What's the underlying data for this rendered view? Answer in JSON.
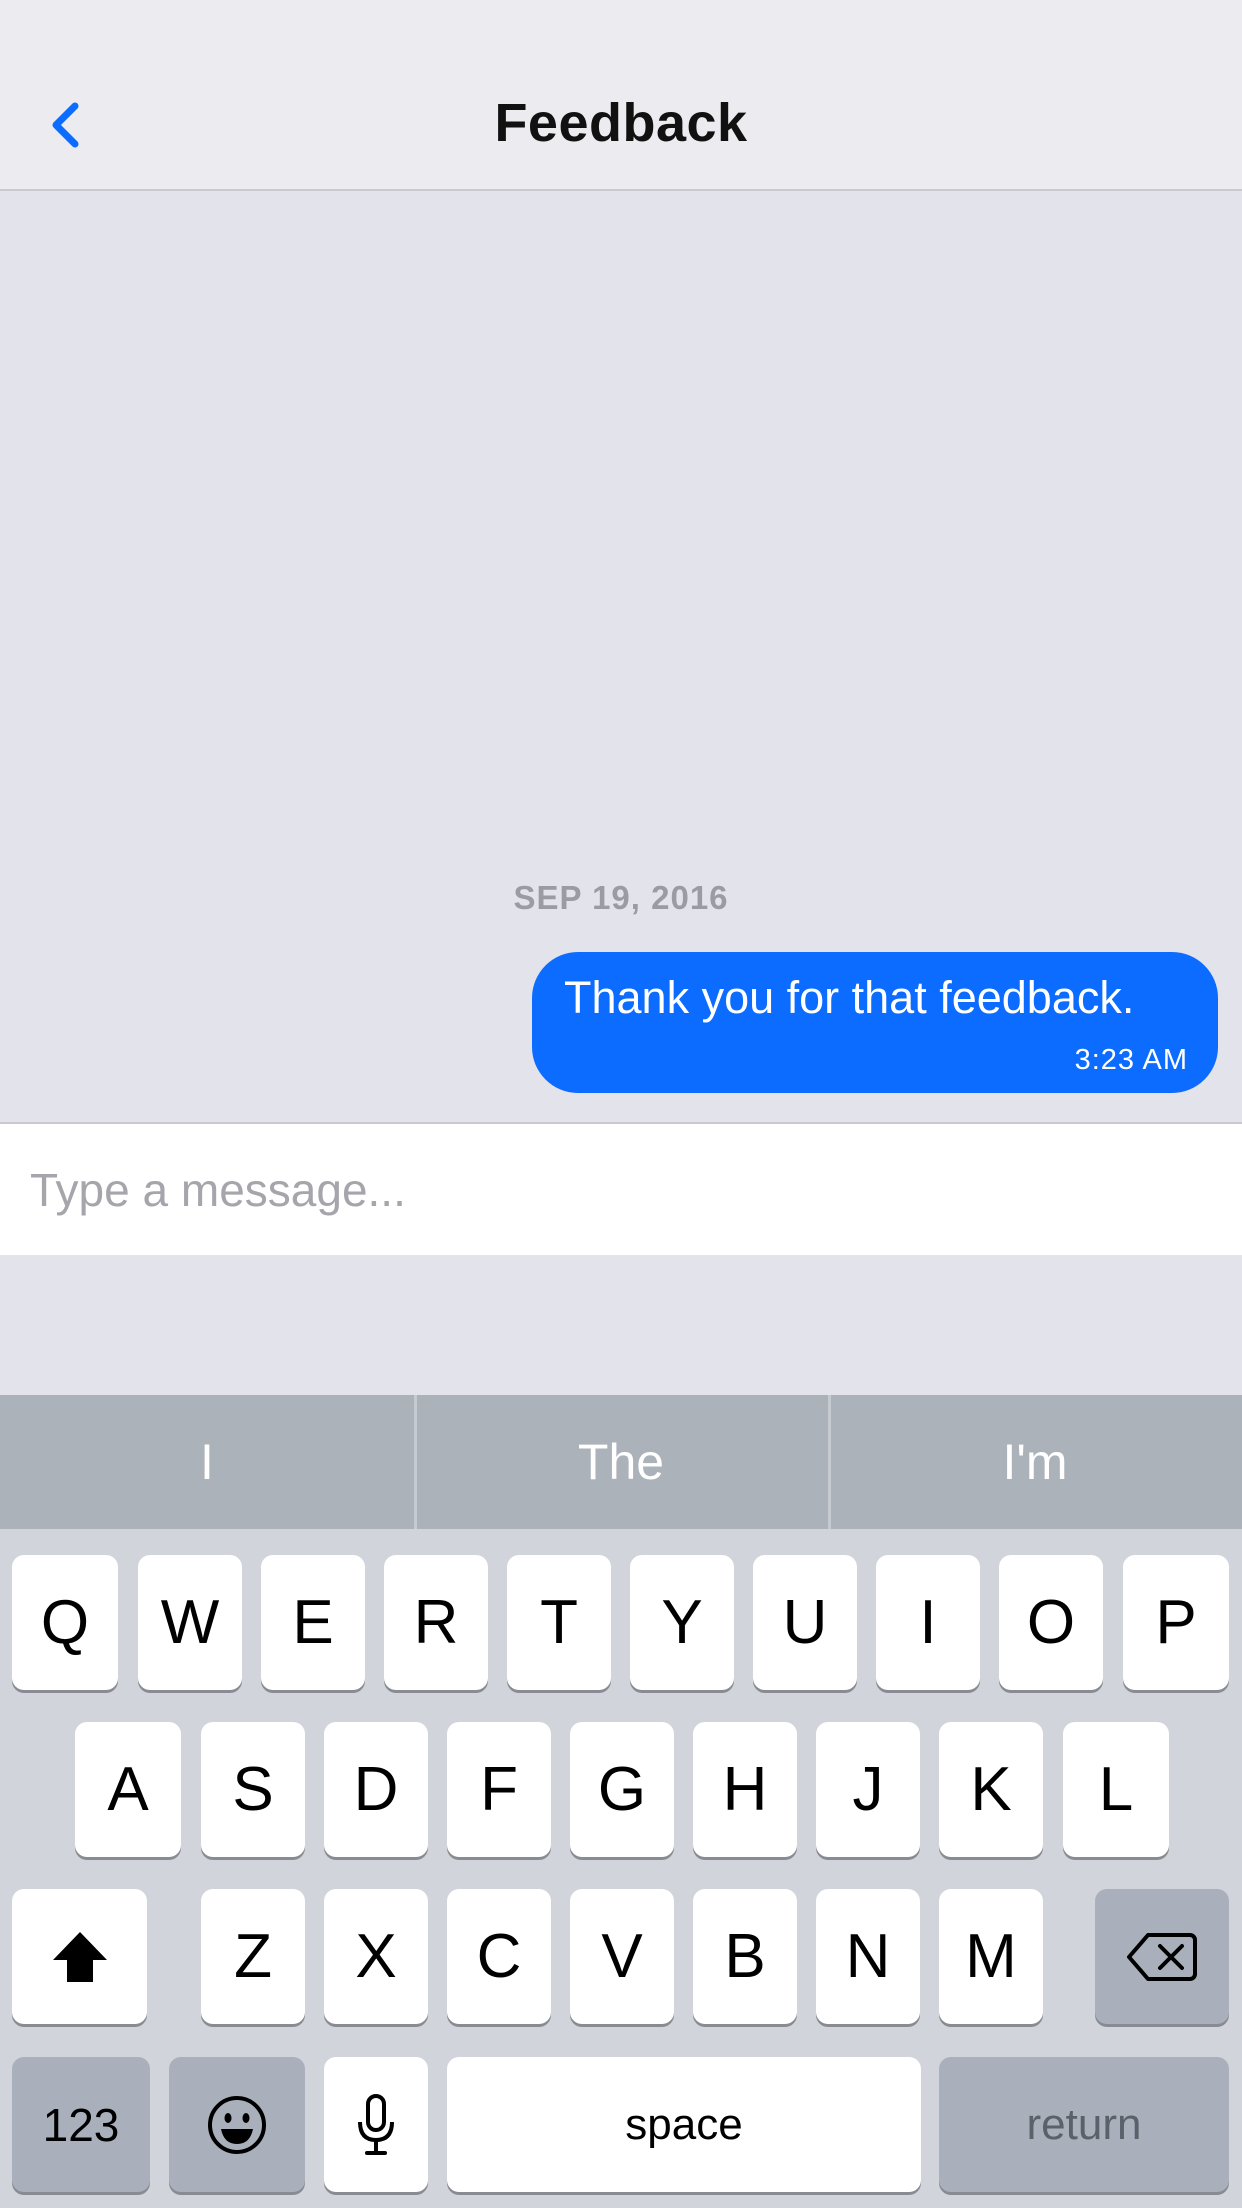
{
  "navbar": {
    "title": "Feedback",
    "back_icon": "chevron-left-icon",
    "accent_color": "#0b6cff"
  },
  "chat": {
    "date_separator": "SEP 19, 2016",
    "messages": [
      {
        "text": "Thank you for that feedback.",
        "time": "3:23 AM",
        "outgoing": true
      }
    ]
  },
  "input": {
    "placeholder": "Type a message...",
    "value": ""
  },
  "keyboard": {
    "suggestions": [
      "I",
      "The",
      "I'm"
    ],
    "row1": [
      "Q",
      "W",
      "E",
      "R",
      "T",
      "Y",
      "U",
      "I",
      "O",
      "P"
    ],
    "row2": [
      "A",
      "S",
      "D",
      "F",
      "G",
      "H",
      "J",
      "K",
      "L"
    ],
    "row3": [
      "Z",
      "X",
      "C",
      "V",
      "B",
      "N",
      "M"
    ],
    "shift_icon": "shift-arrow-icon",
    "delete_icon": "backspace-icon",
    "numbers_label": "123",
    "emoji_icon": "emoji-face-icon",
    "mic_icon": "microphone-icon",
    "space_label": "space",
    "return_label": "return"
  }
}
